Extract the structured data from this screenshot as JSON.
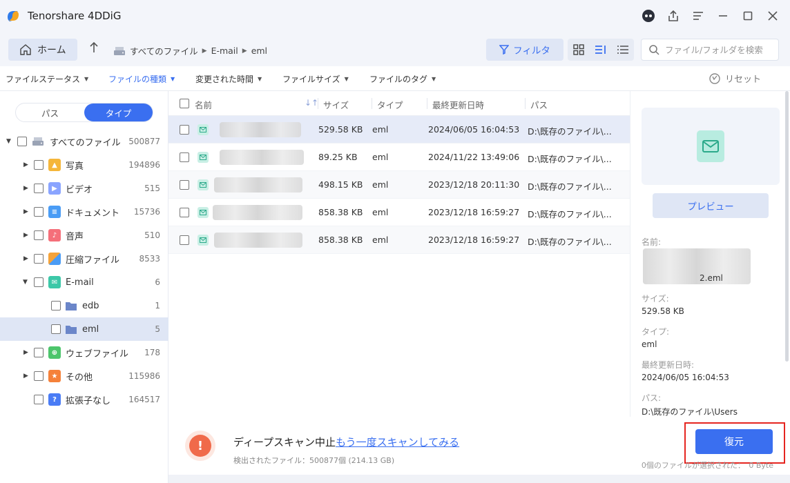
{
  "app": {
    "title": "Tenorshare 4DDiG"
  },
  "toolbar": {
    "home_label": "ホーム",
    "breadcrumb": [
      "すべてのファイル",
      "E-mail",
      "eml"
    ],
    "filter_label": "フィルタ",
    "search_placeholder": "ファイル/フォルダを検索"
  },
  "filters": {
    "items": [
      "ファイルステータス",
      "ファイルの種類",
      "変更された時間",
      "ファイルサイズ",
      "ファイルのタグ"
    ],
    "reset_label": "リセット"
  },
  "sidebar": {
    "seg_path": "パス",
    "seg_type": "タイプ",
    "tree": [
      {
        "label": "すべてのファイル",
        "count": "500877",
        "icon": "drive-icon"
      },
      {
        "label": "写真",
        "count": "194896",
        "icon": "photo-icon",
        "color": "#f5b63a"
      },
      {
        "label": "ビデオ",
        "count": "515",
        "icon": "video-icon",
        "color": "#8aa4ff"
      },
      {
        "label": "ドキュメント",
        "count": "15736",
        "icon": "document-icon",
        "color": "#4a9cf5"
      },
      {
        "label": "音声",
        "count": "510",
        "icon": "audio-icon",
        "color": "#f56f7a"
      },
      {
        "label": "圧縮ファイル",
        "count": "8533",
        "icon": "archive-icon",
        "color": "#f5a33a"
      },
      {
        "label": "E-mail",
        "count": "6",
        "icon": "mail-icon",
        "color": "#3cc8a8"
      },
      {
        "label": "edb",
        "count": "1",
        "icon": "folder-icon",
        "color": "#6b86c9"
      },
      {
        "label": "eml",
        "count": "5",
        "icon": "folder-icon",
        "color": "#6b86c9"
      },
      {
        "label": "ウェブファイル",
        "count": "178",
        "icon": "web-icon",
        "color": "#4cc56b"
      },
      {
        "label": "その他",
        "count": "115986",
        "icon": "other-icon",
        "color": "#f5813a"
      },
      {
        "label": "拡張子なし",
        "count": "164517",
        "icon": "unknown-icon",
        "color": "#4a7cf5"
      }
    ]
  },
  "table": {
    "headers": {
      "name": "名前",
      "size": "サイズ",
      "type": "タイプ",
      "modified": "最終更新日時",
      "path": "パス"
    },
    "rows": [
      {
        "size": "529.58 KB",
        "type": "eml",
        "modified": "2024/06/05 16:04:53",
        "path": "D:\\既存のファイル\\..."
      },
      {
        "size": "89.25 KB",
        "type": "eml",
        "modified": "2024/11/22 13:49:06",
        "path": "D:\\既存のファイル\\..."
      },
      {
        "size": "498.15 KB",
        "type": "eml",
        "modified": "2023/12/18 20:11:30",
        "path": "D:\\既存のファイル\\..."
      },
      {
        "size": "858.38 KB",
        "type": "eml",
        "modified": "2023/12/18 16:59:27",
        "path": "D:\\既存のファイル\\..."
      },
      {
        "size": "858.38 KB",
        "type": "eml",
        "modified": "2023/12/18 16:59:27",
        "path": "D:\\既存のファイル\\..."
      }
    ]
  },
  "preview": {
    "button_label": "プレビュー",
    "name_label": "名前:",
    "name_suffix": "2.eml",
    "size_label": "サイズ:",
    "size_value": "529.58 KB",
    "type_label": "タイプ:",
    "type_value": "eml",
    "modified_label": "最終更新日時:",
    "modified_value": "2024/06/05 16:04:53",
    "path_label": "パス:",
    "path_value": "D:\\既存のファイル\\Users"
  },
  "bottom": {
    "stop_text": "ディープスキャン中止",
    "rescan_link": "もう一度スキャンしてみる",
    "found_text": "検出されたファイル：500877個 (214.13 GB)",
    "recover_label": "復元",
    "selected_text": "0個のファイルが選択された：　0 Byte"
  },
  "colors": {
    "accent": "#3a6ff0",
    "highlight": "#e5241f"
  }
}
